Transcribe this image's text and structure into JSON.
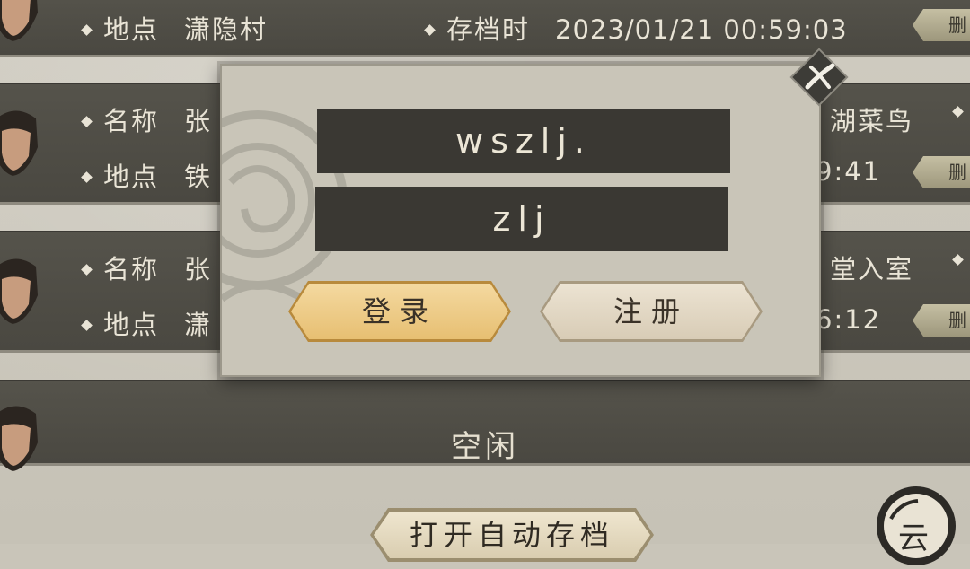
{
  "slots": [
    {
      "location_label": "地点",
      "location": "潇隐村",
      "time_label": "存档时",
      "time": "2023/01/21  00:59:03",
      "delete_label": "删"
    },
    {
      "name_label": "名称",
      "name": "张",
      "title_partial": "湖菜鸟",
      "location_label": "地点",
      "location": "铁",
      "time_partial": "9:41",
      "delete_label": "删"
    },
    {
      "name_label": "名称",
      "name": "张",
      "title_partial": "堂入室",
      "location_label": "地点",
      "location": "潇",
      "time_partial": "6:12",
      "delete_label": "删"
    },
    {
      "status": "空闲"
    }
  ],
  "dialog": {
    "username": "wszlj.",
    "password": "zlj",
    "login_label": "登录",
    "register_label": "注册",
    "close_icon": "close-x-icon"
  },
  "autosave_label": "打开自动存档",
  "cloud_label": "云",
  "colors": {
    "slot_bg": "#4e4c45",
    "dialog_bg": "#c9c5b8",
    "field_bg": "#3a3833",
    "login_gold": "#e7bf72",
    "register_cream": "#ddd1bb"
  }
}
